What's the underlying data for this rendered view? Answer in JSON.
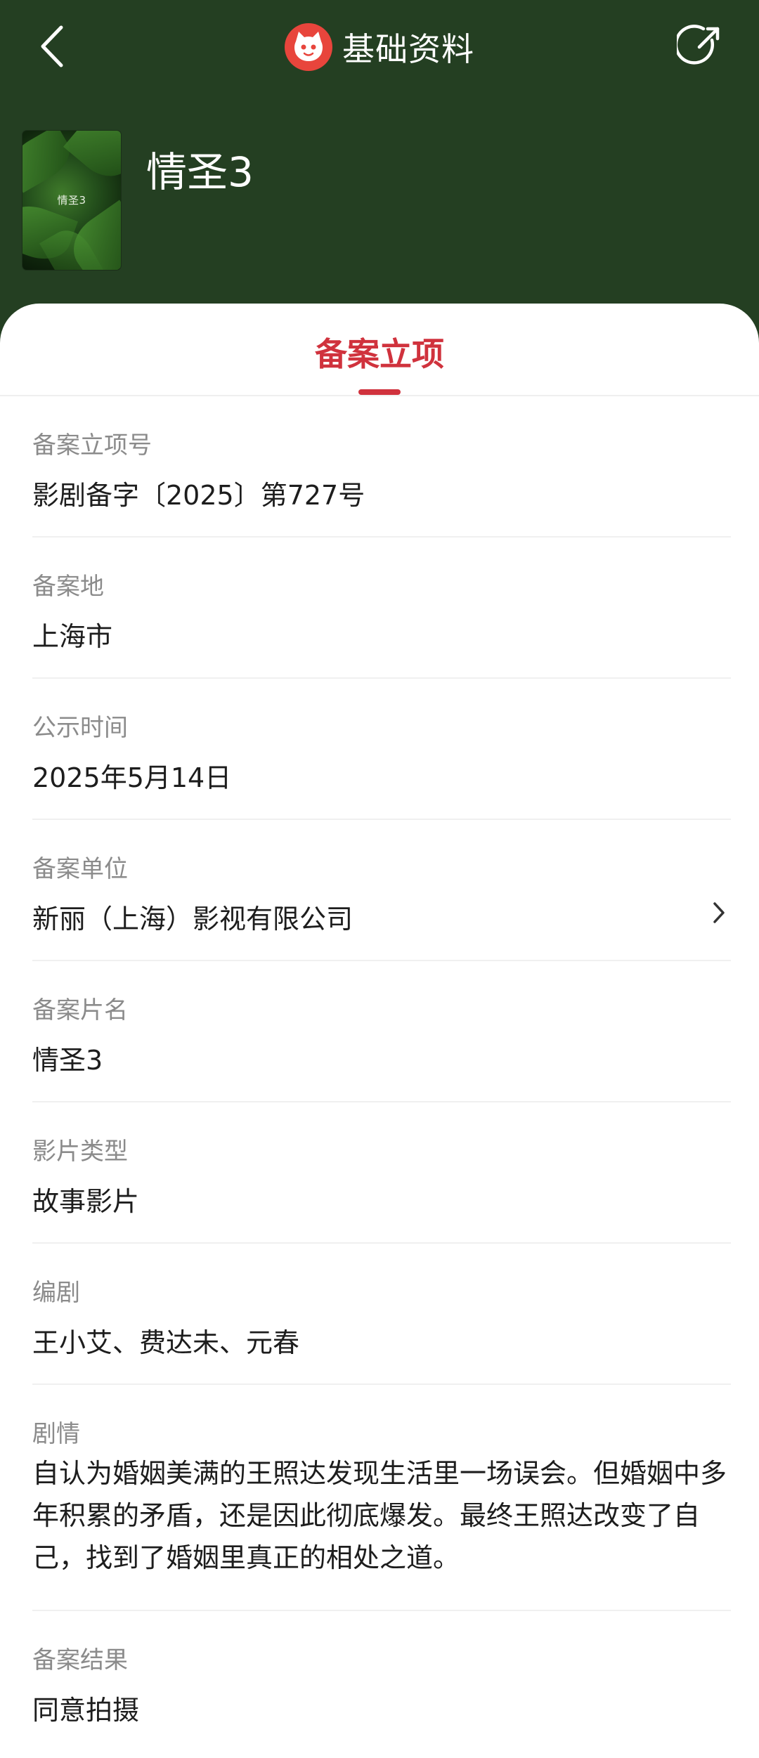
{
  "header": {
    "title": "基础资料",
    "icons": {
      "back": "back-chevron-icon",
      "logo": "cat-logo-icon",
      "share": "share-icon"
    },
    "colors": {
      "background": "#243f22",
      "logo": "#e8453c"
    }
  },
  "movie": {
    "title": "情圣3",
    "poster_text": "情圣3"
  },
  "tab": {
    "label": "备案立项",
    "accent_color": "#d0323d"
  },
  "fields": [
    {
      "label": "备案立项号",
      "value": "影剧备字〔2025〕第727号"
    },
    {
      "label": "备案地",
      "value": "上海市"
    },
    {
      "label": "公示时间",
      "value": "2025年5月14日"
    },
    {
      "label": "备案单位",
      "value": "新丽（上海）影视有限公司"
    },
    {
      "label": "备案片名",
      "value": "情圣3"
    },
    {
      "label": "影片类型",
      "value": "故事影片"
    },
    {
      "label": "编剧",
      "value": "王小艾、费达未、元春"
    },
    {
      "label": "剧情",
      "value": "自认为婚姻美满的王照达发现生活里一场误会。但婚姻中多年积累的矛盾，还是因此彻底爆发。最终王照达改变了自己，找到了婚姻里真正的相处之道。"
    },
    {
      "label": "备案结果",
      "value": "同意拍摄"
    }
  ]
}
